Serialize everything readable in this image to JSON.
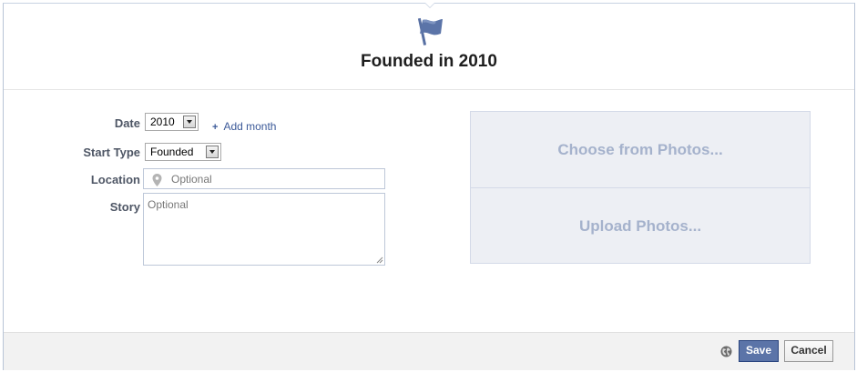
{
  "header": {
    "title": "Founded in 2010",
    "icon": "flag-icon"
  },
  "form": {
    "date_label": "Date",
    "date_value": "2010",
    "add_month": "Add month",
    "start_type_label": "Start Type",
    "start_type_value": "Founded",
    "location_label": "Location",
    "location_placeholder": "Optional",
    "story_label": "Story",
    "story_placeholder": "Optional"
  },
  "photos": {
    "choose_label": "Choose from Photos...",
    "upload_label": "Upload Photos..."
  },
  "footer": {
    "privacy_icon": "globe-icon",
    "save_label": "Save",
    "cancel_label": "Cancel"
  },
  "colors": {
    "accent": "#3b5998",
    "save_bg": "#5b74a8",
    "photo_panel_bg": "#edeff4",
    "photo_text": "#a5b2cc"
  }
}
